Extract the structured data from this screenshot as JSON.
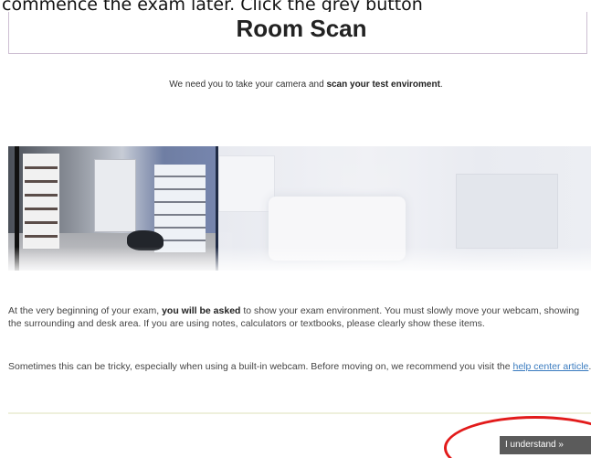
{
  "caption": {
    "text": "commence the exam later. Click the grey button"
  },
  "header": {
    "title": "Room Scan"
  },
  "intro": {
    "before": "We need you to take your camera and ",
    "bold": "scan your test enviroment",
    "after": "."
  },
  "paragraph1": {
    "before": "At the very beginning of your exam, ",
    "bold": "you will be asked",
    "after": " to show your exam environment. You must slowly move your webcam, showing the surrounding and desk area. If you are using notes, calculators or textbooks, please clearly show these items."
  },
  "paragraph2": {
    "before": "Sometimes this can be tricky, especially when using a built-in webcam. Before moving on, we recommend you visit the ",
    "link": "help center article",
    "after": "."
  },
  "footer": {
    "button_label": "I understand »"
  },
  "annotation": {
    "color": "#e21b1b"
  },
  "colors": {
    "button": "#5b5b5b",
    "link": "#3a7bbf",
    "title_border": "#cdbfd2"
  }
}
